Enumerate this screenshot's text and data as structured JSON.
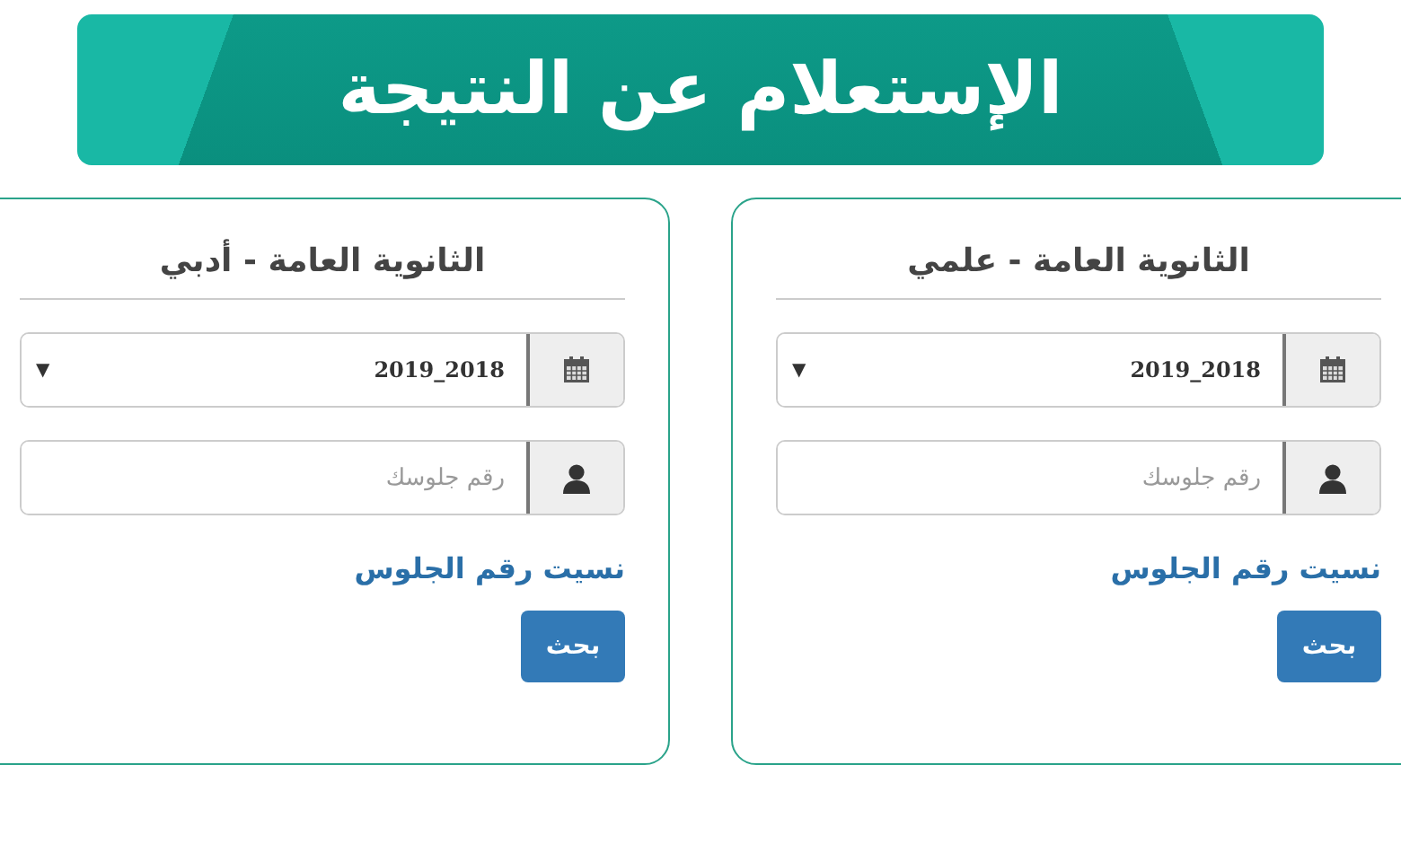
{
  "banner": {
    "title": "الإستعلام عن النتيجة"
  },
  "cards": [
    {
      "title": "الثانوية العامة - علمي",
      "year": {
        "value": "2019_2018",
        "arrow": "▼"
      },
      "seat": {
        "placeholder": "رقم جلوسك"
      },
      "link": "نسيت رقم الجلوس",
      "button": "بحث"
    },
    {
      "title": "الثانوية العامة - أدبي",
      "year": {
        "value": "2019_2018",
        "arrow": "▼"
      },
      "seat": {
        "placeholder": "رقم جلوسك"
      },
      "link": "نسيت رقم الجلوس",
      "button": "بحث"
    }
  ]
}
